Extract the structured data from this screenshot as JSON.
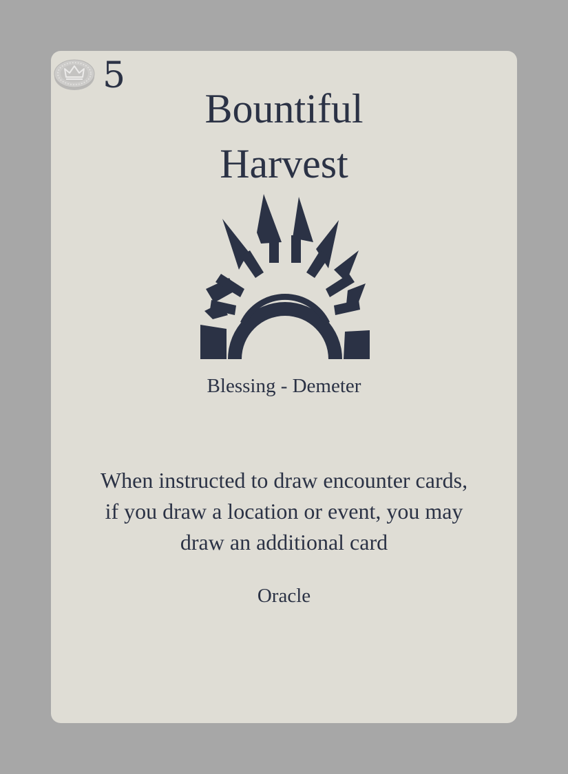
{
  "card": {
    "cost": "5",
    "title_lines": [
      "Bountiful",
      "Harvest"
    ],
    "subtitle": "Blessing - Demeter",
    "rules_lines": [
      "When instructed to draw encounter cards,",
      "if you draw a location or event, you may",
      "draw an additional card"
    ],
    "keyword": "Oracle"
  },
  "colors": {
    "background": "#a7a7a7",
    "card": "#dfddd5",
    "ink": "#2b3245",
    "coin": "#c9c8c6"
  },
  "icons": {
    "cost": "silver-crown-coin-icon",
    "emblem": "rising-sun-icon"
  }
}
